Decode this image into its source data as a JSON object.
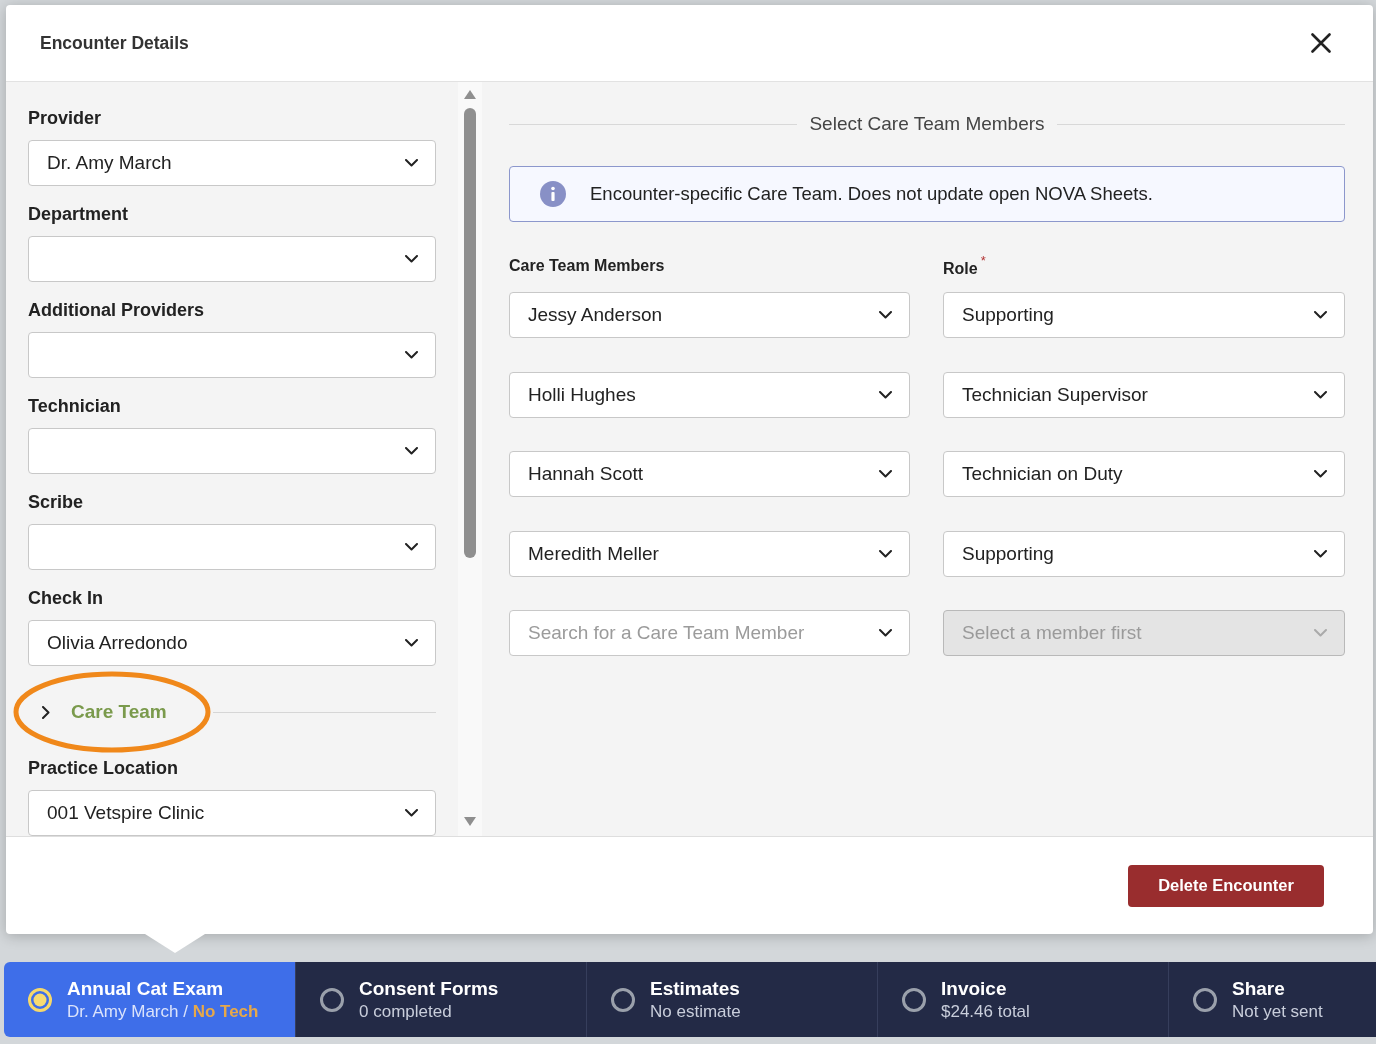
{
  "dialog": {
    "title": "Encounter Details"
  },
  "left_form": {
    "fields": [
      {
        "label": "Provider",
        "value": "Dr. Amy March"
      },
      {
        "label": "Department"
      },
      {
        "label": "Additional Providers"
      },
      {
        "label": "Technician"
      },
      {
        "label": "Scribe"
      },
      {
        "label": "Check In",
        "value": "Olivia Arredondo"
      }
    ],
    "section": {
      "label": "Care Team",
      "expanded": false
    },
    "fields_below": [
      {
        "label": "Practice Location",
        "value": "001 Vetspire Clinic"
      }
    ]
  },
  "care_team": {
    "title": "Select Care Team Members",
    "notice": "Encounter-specific Care Team. Does not update open NOVA Sheets.",
    "columns": [
      {
        "label": "Care Team Members"
      },
      {
        "label": "Role",
        "required_mark": "*"
      }
    ],
    "rows": [
      {
        "member": "Jessy Anderson",
        "role": "Supporting"
      },
      {
        "member": "Holli Hughes",
        "role": "Technician Supervisor"
      },
      {
        "member": "Hannah Scott",
        "role": "Technician on Duty"
      },
      {
        "member": "Meredith Meller",
        "role": "Supporting"
      }
    ],
    "new_row": {
      "member_placeholder": "Search for a Care Team Member",
      "role_placeholder": "Select a member first",
      "role_disabled": true
    }
  },
  "footer": {
    "buttons": [
      {
        "label": "Delete Encounter",
        "kind": "danger"
      }
    ]
  },
  "workflow_tabs": [
    {
      "title": "Annual Cat Exam",
      "subtitle": "Dr. Amy March / **No Tech**",
      "selected": true
    },
    {
      "title": "Consent Forms",
      "subtitle": "0 completed",
      "selected": false
    },
    {
      "title": "Estimates",
      "subtitle": "No estimate",
      "selected": false
    },
    {
      "title": "Invoice",
      "subtitle": "$24.46 total",
      "selected": false
    },
    {
      "title": "Share",
      "subtitle": "Not yet sent",
      "selected": false
    }
  ]
}
